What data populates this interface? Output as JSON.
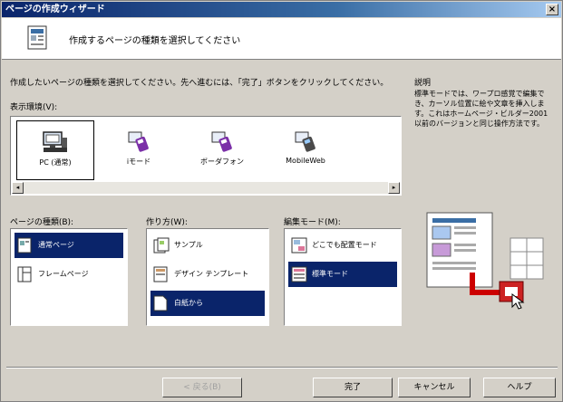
{
  "window": {
    "title": "ページの作成ウィザード",
    "close_label": "×"
  },
  "header": {
    "text": "作成するページの種類を選択してください"
  },
  "instruction": "作成したいページの種類を選択してください。先へ進むには、「完了」ボタンをクリックしてください。",
  "environment": {
    "label": "表示環境(V):",
    "items": [
      {
        "label": "PC (通常)",
        "icon": "pc-icon",
        "selected": true
      },
      {
        "label": "iモード",
        "icon": "imode-phone-icon"
      },
      {
        "label": "ボーダフォン",
        "icon": "vodafone-phone-icon"
      },
      {
        "label": "MobileWeb",
        "icon": "mobileweb-phone-icon"
      }
    ],
    "scroll_left": "◂",
    "scroll_right": "▸"
  },
  "description": {
    "title": "説明",
    "body": "標準モードでは、ワープロ感覚で編集でき、カーソル位置に絵や文章を挿入します。これはホームページ・ビルダー2001以前のバージョンと同じ操作方法です。"
  },
  "page_type": {
    "label": "ページの種類(B):",
    "items": [
      {
        "label": "通常ページ",
        "selected": true
      },
      {
        "label": "フレームページ"
      }
    ]
  },
  "method": {
    "label": "作り方(W):",
    "items": [
      {
        "label": "サンプル"
      },
      {
        "label": "デザイン テンプレート"
      },
      {
        "label": "白紙から",
        "selected": true
      }
    ]
  },
  "edit_mode": {
    "label": "編集モード(M):",
    "items": [
      {
        "label": "どこでも配置モード"
      },
      {
        "label": "標準モード",
        "selected": true
      }
    ]
  },
  "buttons": {
    "back": "< 戻る(B)",
    "finish": "完了",
    "cancel": "キャンセル",
    "help": "ヘルプ"
  }
}
